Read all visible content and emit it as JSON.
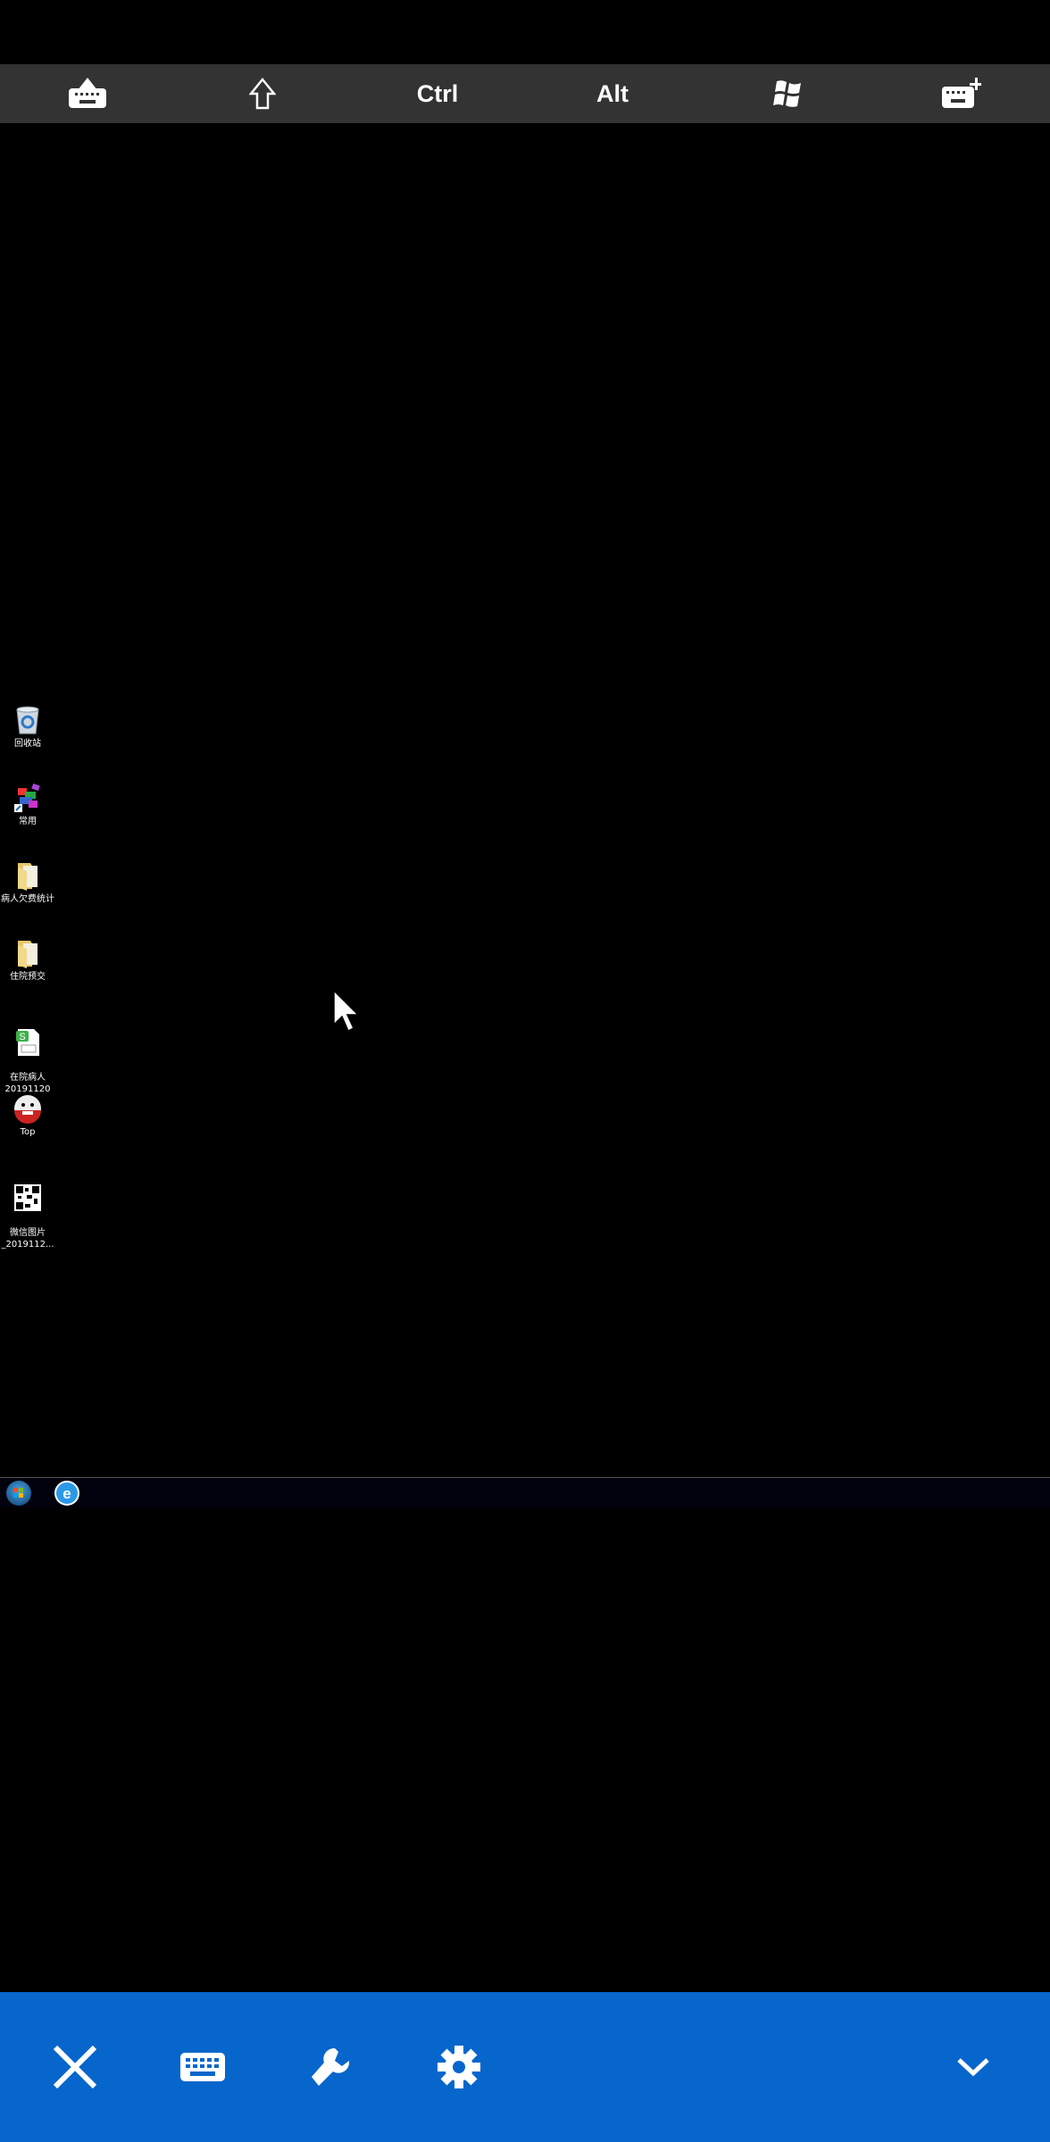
{
  "keybar": {
    "items": [
      {
        "icon": "keyboard-hide-icon"
      },
      {
        "icon": "shift-arrow-icon"
      },
      {
        "label": "Ctrl"
      },
      {
        "label": "Alt"
      },
      {
        "icon": "windows-logo-icon"
      },
      {
        "icon": "keyboard-add-icon"
      }
    ]
  },
  "desktop": {
    "icons": [
      {
        "label": "回收站",
        "icon": "recycle-bin-icon"
      },
      {
        "label": "常用",
        "icon": "app-shortcut-icon"
      },
      {
        "label": "病人欠费统计",
        "icon": "folder-icon"
      },
      {
        "label": "住院预交",
        "icon": "folder-icon"
      },
      {
        "label": "在院病人\n20191120",
        "icon": "spreadsheet-icon"
      },
      {
        "label": "Top",
        "icon": "top-app-icon"
      },
      {
        "label": "微信图片\n_2019112...",
        "icon": "qr-image-icon"
      }
    ]
  },
  "taskbar": {
    "items": [
      {
        "icon": "start-orb-icon"
      },
      {
        "icon": "ie-browser-icon"
      }
    ]
  },
  "bottom_bar": {
    "accent": "#0766cc",
    "items": [
      {
        "icon": "close-icon"
      },
      {
        "icon": "keyboard-icon"
      },
      {
        "icon": "wrench-icon"
      },
      {
        "icon": "gear-icon"
      },
      {
        "icon": "chevron-down-icon"
      }
    ]
  }
}
